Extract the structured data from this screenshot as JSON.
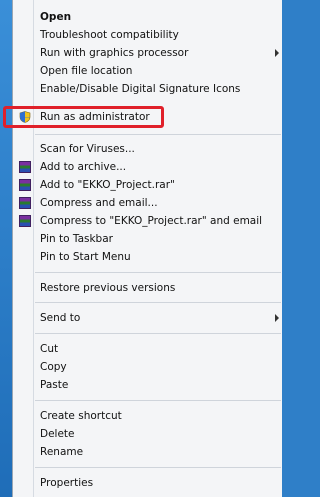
{
  "menu": {
    "items": [
      {
        "label": "Open",
        "bold": true
      },
      {
        "label": "Troubleshoot compatibility"
      },
      {
        "label": "Run with graphics processor",
        "submenu": true
      },
      {
        "label": "Open file location"
      },
      {
        "label": "Enable/Disable Digital Signature Icons"
      },
      {
        "label": "Run as administrator",
        "icon": "uac-shield-icon",
        "highlighted": true
      },
      {
        "label": "Scan for Viruses..."
      },
      {
        "label": "Add to archive...",
        "icon": "winrar-icon"
      },
      {
        "label": "Add to \"EKKO_Project.rar\"",
        "icon": "winrar-icon"
      },
      {
        "label": "Compress and email...",
        "icon": "winrar-icon"
      },
      {
        "label": "Compress to \"EKKO_Project.rar\" and email",
        "icon": "winrar-icon"
      },
      {
        "label": "Pin to Taskbar"
      },
      {
        "label": "Pin to Start Menu"
      },
      {
        "label": "Restore previous versions"
      },
      {
        "label": "Send to",
        "submenu": true
      },
      {
        "label": "Cut"
      },
      {
        "label": "Copy"
      },
      {
        "label": "Paste"
      },
      {
        "label": "Create shortcut"
      },
      {
        "label": "Delete"
      },
      {
        "label": "Rename"
      },
      {
        "label": "Properties"
      }
    ]
  },
  "colors": {
    "highlight_border": "#e0202a",
    "menu_background": "#f4f5f7"
  }
}
